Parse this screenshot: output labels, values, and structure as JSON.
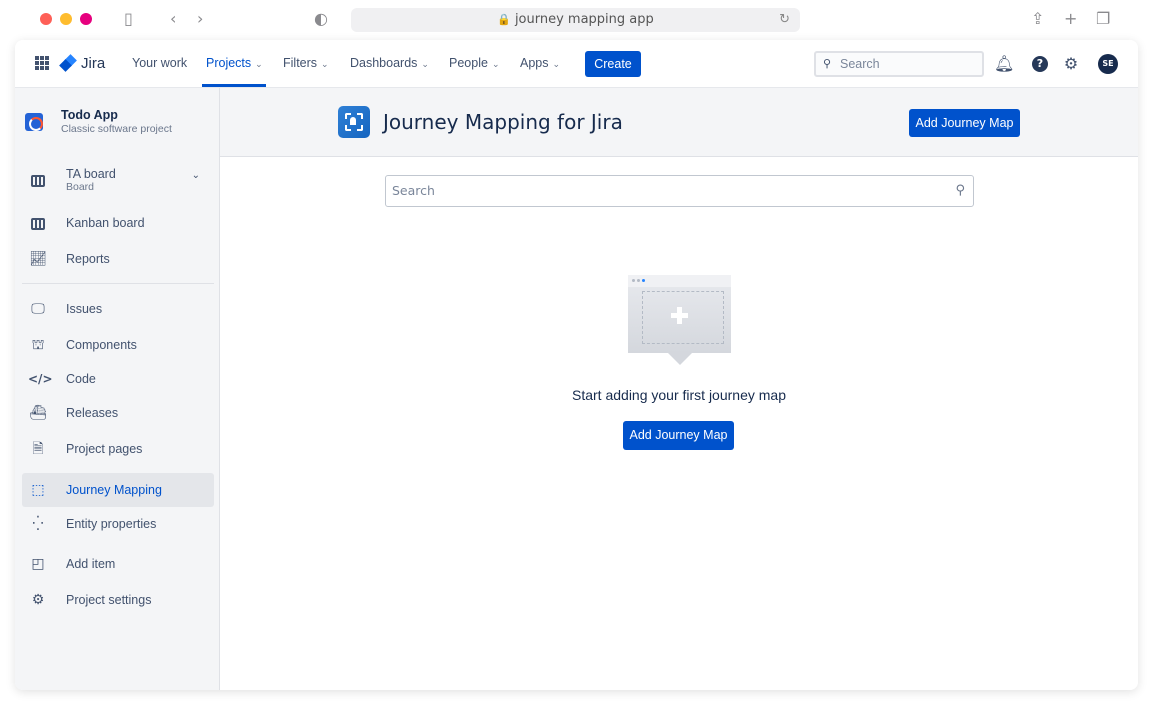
{
  "browser": {
    "url": "journey mapping app"
  },
  "topnav": {
    "brand": "Jira",
    "items": [
      {
        "label": "Your work",
        "dropdown": false
      },
      {
        "label": "Projects",
        "dropdown": true,
        "active": true
      },
      {
        "label": "Filters",
        "dropdown": true
      },
      {
        "label": "Dashboards",
        "dropdown": true
      },
      {
        "label": "People",
        "dropdown": true
      },
      {
        "label": "Apps",
        "dropdown": true
      }
    ],
    "create_label": "Create",
    "search_placeholder": "Search",
    "avatar_initials": "SE"
  },
  "sidebar": {
    "project_name": "Todo App",
    "project_type": "Classic software project",
    "board_name": "TA board",
    "board_sub": "Board",
    "items": [
      {
        "label": "Kanban board",
        "icon": "kanban-icon"
      },
      {
        "label": "Reports",
        "icon": "reports-icon"
      },
      {
        "label": "Issues",
        "icon": "issues-icon"
      },
      {
        "label": "Components",
        "icon": "components-icon"
      },
      {
        "label": "Code",
        "icon": "code-icon"
      },
      {
        "label": "Releases",
        "icon": "releases-icon"
      },
      {
        "label": "Project pages",
        "icon": "pages-icon"
      },
      {
        "label": "Journey Mapping",
        "icon": "journey-mapping-icon",
        "selected": true
      },
      {
        "label": "Entity properties",
        "icon": "entity-properties-icon"
      },
      {
        "label": "Add item",
        "icon": "add-item-icon"
      },
      {
        "label": "Project settings",
        "icon": "settings-icon"
      }
    ]
  },
  "main": {
    "title": "Journey Mapping for Jira",
    "header_button": "Add Journey Map",
    "search_placeholder": "Search",
    "empty_text": "Start adding your first journey map",
    "empty_button": "Add Journey Map"
  },
  "colors": {
    "primary": "#0052cc",
    "sidebar_bg": "#f4f5f7",
    "text": "#172b4d"
  }
}
